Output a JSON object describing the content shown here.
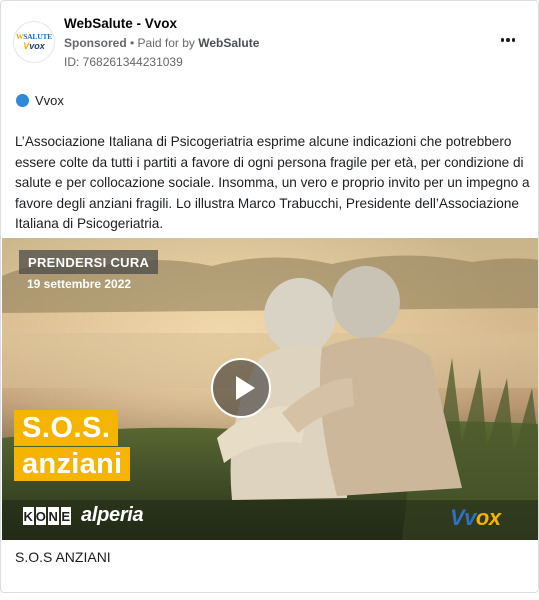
{
  "header": {
    "avatar_logo_top": "SALUTE",
    "avatar_logo_top_prefix": "W",
    "avatar_logo_bottom": "vox",
    "avatar_logo_bottom_prefix": "V",
    "page_name": "WebSalute - Vvox",
    "sponsored": "Sponsored",
    "paid_for_by_prefix": " • Paid for by ",
    "paid_for_by": "WebSalute",
    "ad_id": "ID: 768261344231039",
    "more_icon": "more-horizontal-icon"
  },
  "platform": {
    "icon": "facebook-dot-icon",
    "label": "Vvox",
    "color": "#2f89d8"
  },
  "body_text": "L’Associazione Italiana di Psicogeriatria esprime alcune indicazioni che potrebbero essere colte da tutti i partiti a favore di ogni persona fragile per età, per condizione di salute e per collocazione sociale. Insomma, un vero e proprio invito per un impegno a favore degli anziani fragili. Lo illustra Marco Trabucchi, Presidente dell’Associazione Italiana di Psicogeriatria.",
  "media": {
    "tag": "PRENDERSI CURA",
    "date": "19 settembre 2022",
    "headline_line1": "S.O.S.",
    "headline_line2": "anziani",
    "sponsor1_letters": [
      "K",
      "O",
      "N",
      "E"
    ],
    "sponsor2": "alperia",
    "brand_prefix": "Vv",
    "brand_suffix": "ox",
    "accent_color": "#f5b400",
    "play_icon": "play-icon"
  },
  "caption": "S.O.S ANZIANI"
}
